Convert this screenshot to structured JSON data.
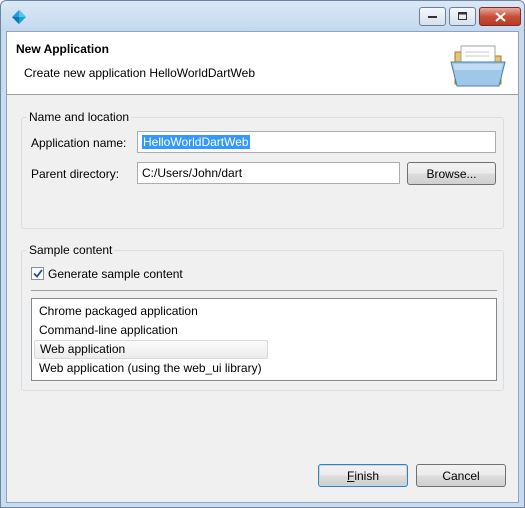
{
  "window": {
    "title": ""
  },
  "header": {
    "title": "New Application",
    "description": "Create new application HelloWorldDartWeb"
  },
  "name_location": {
    "group_label": "Name and location",
    "app_name_label": "Application name:",
    "app_name_value": "HelloWorldDartWeb",
    "parent_dir_label": "Parent directory:",
    "parent_dir_value": "C:/Users/John/dart",
    "browse_label": "Browse..."
  },
  "sample_content": {
    "group_label": "Sample content",
    "generate_label": "Generate sample content",
    "generate_checked": true,
    "items": [
      {
        "label": "Chrome packaged application"
      },
      {
        "label": "Command-line application"
      },
      {
        "label": "Web application"
      },
      {
        "label": "Web application (using the web_ui library)"
      }
    ],
    "selected_index": 2
  },
  "footer": {
    "finish_mnemonic": "F",
    "finish_rest": "inish",
    "cancel_label": "Cancel"
  },
  "colors": {
    "selection": "#3399ff",
    "titlebar": "#c9dcef",
    "dart_icon": "#1d9fd8"
  }
}
